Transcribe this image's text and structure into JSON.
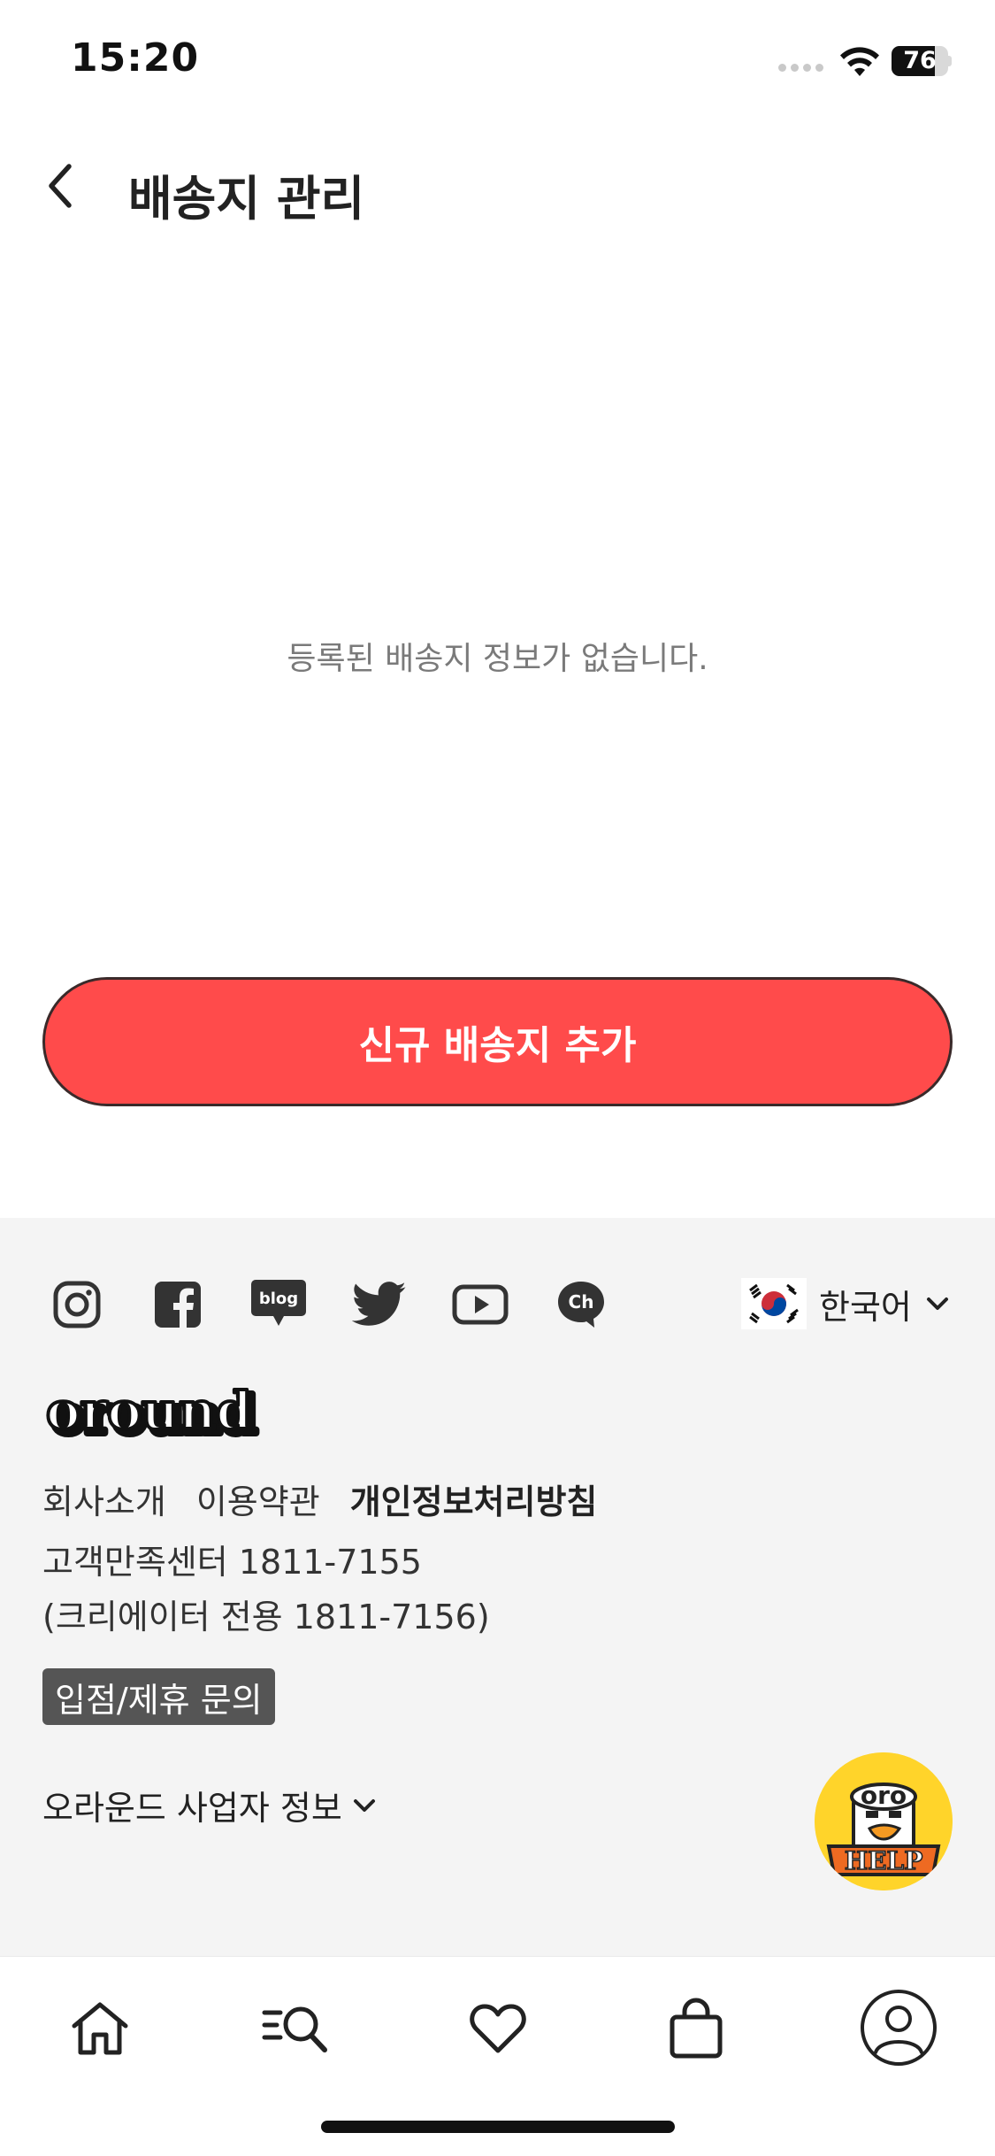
{
  "status_bar": {
    "time": "15:20",
    "battery_level": "76",
    "battery_fraction": 0.76
  },
  "header": {
    "title": "배송지 관리",
    "back_icon": "chevron-left-icon"
  },
  "main": {
    "empty_message": "등록된 배송지 정보가 없습니다.",
    "add_button_label": "신규 배송지 추가",
    "accent_color": "#ff4b4b"
  },
  "footer": {
    "social_icons": [
      "instagram-icon",
      "facebook-icon",
      "blog-icon",
      "twitter-icon",
      "youtube-icon",
      "kakao-channel-icon"
    ],
    "blog_icon_text": "blog",
    "channel_icon_text": "Ch",
    "language": "한국어",
    "brand_name": "oround",
    "links": {
      "company": "회사소개",
      "terms": "이용약관",
      "privacy": "개인정보처리방침"
    },
    "customer_center": "고객만족센터 1811-7155",
    "creator_line": "(크리에이터 전용 1811-7156)",
    "inquiry_label": "입점/제휴 문의",
    "business_info_label": "오라운드 사업자 정보",
    "help": {
      "top_text": "oro",
      "bottom_text": "HELP"
    },
    "background_color": "#f4f4f4"
  },
  "bottom_nav": {
    "items": [
      "home-icon",
      "search-list-icon",
      "heart-icon",
      "shopping-bag-icon",
      "profile-icon"
    ]
  }
}
